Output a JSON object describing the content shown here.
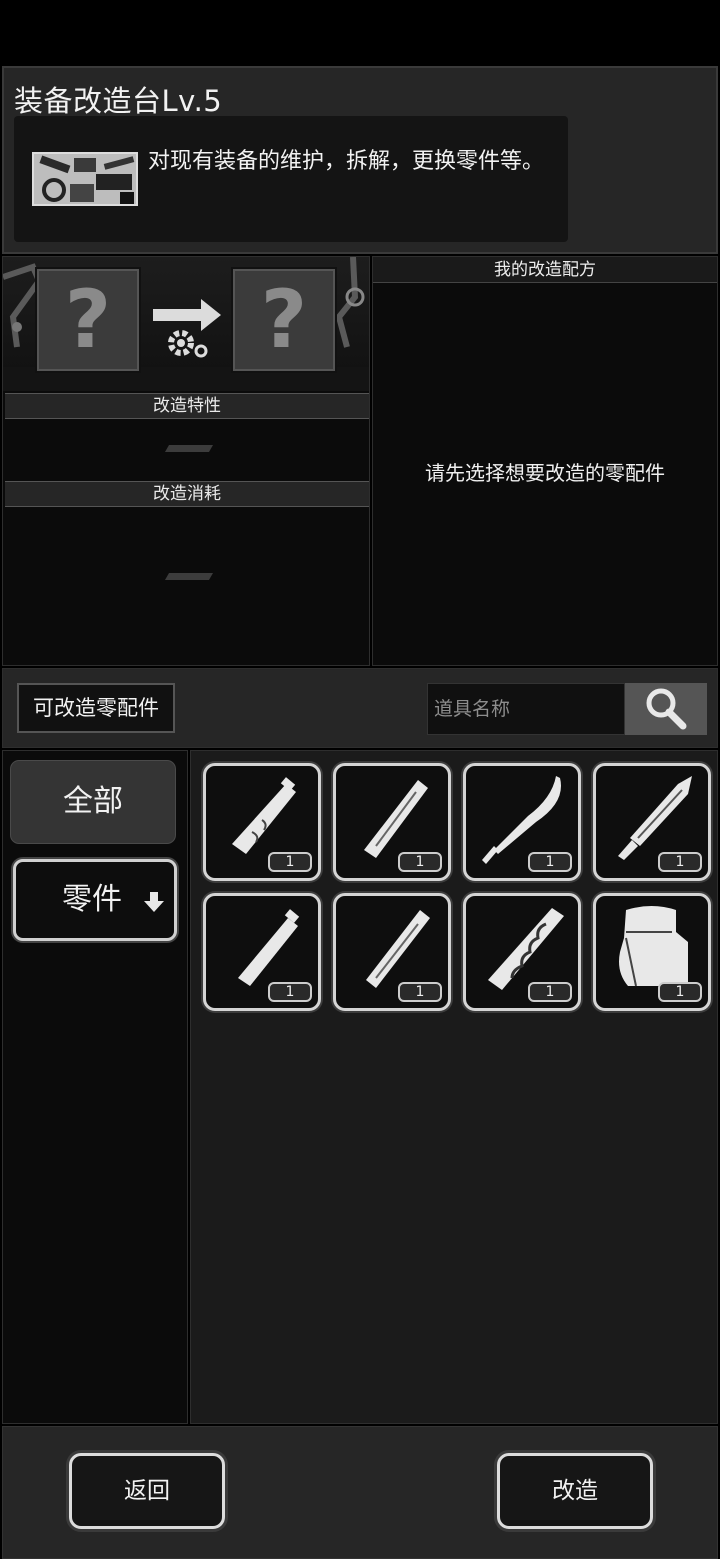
{
  "header": {
    "title": "装备改造台Lv.5",
    "description": "对现有装备的维护，拆解，更换零件等。"
  },
  "craft": {
    "input_slot": "?",
    "output_slot": "?",
    "traits_label": "改造特性",
    "cost_label": "改造消耗"
  },
  "recipes": {
    "title": "我的改造配方",
    "empty_message": "请先选择想要改造的零配件"
  },
  "filter": {
    "tab_label": "可改造零配件",
    "search_placeholder": "道具名称"
  },
  "categories": {
    "all": "全部",
    "parts": "零件"
  },
  "items": [
    {
      "icon": "wooden-grip-icon",
      "count": "1"
    },
    {
      "icon": "metal-rod-icon",
      "count": "1"
    },
    {
      "icon": "curved-blade-icon",
      "count": "1"
    },
    {
      "icon": "knife-blade-icon",
      "count": "1"
    },
    {
      "icon": "short-handle-icon",
      "count": "1"
    },
    {
      "icon": "long-rod-icon",
      "count": "1"
    },
    {
      "icon": "ornate-handle-icon",
      "count": "1"
    },
    {
      "icon": "cloth-pouch-icon",
      "count": "1"
    }
  ],
  "footer": {
    "back_label": "返回",
    "modify_label": "改造"
  }
}
